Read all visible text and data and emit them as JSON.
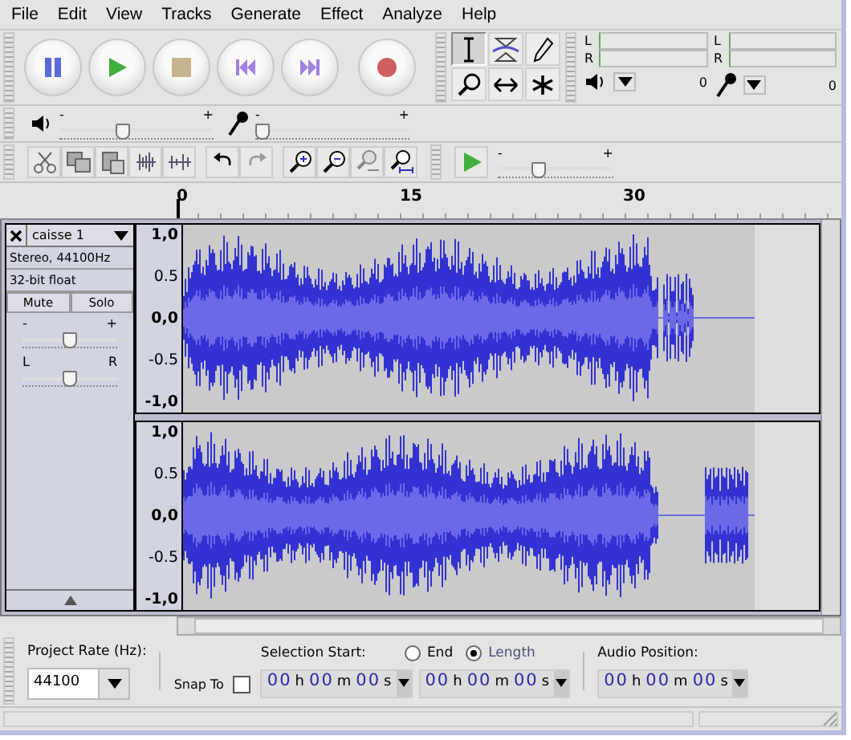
{
  "menu": [
    "File",
    "Edit",
    "View",
    "Tracks",
    "Generate",
    "Effect",
    "Analyze",
    "Help"
  ],
  "transport": [
    {
      "kind": "pause"
    },
    {
      "kind": "play"
    },
    {
      "kind": "stop"
    },
    {
      "kind": "start"
    },
    {
      "kind": "end"
    },
    {
      "kind": "record"
    }
  ],
  "tools": [
    {
      "kind": "select",
      "selected": true
    },
    {
      "kind": "envelope",
      "selected": false
    },
    {
      "kind": "draw",
      "selected": false
    },
    {
      "kind": "zoom",
      "selected": false
    },
    {
      "kind": "timeshift",
      "selected": false
    },
    {
      "kind": "multi",
      "selected": false
    }
  ],
  "meters": [
    {
      "kind": "playback",
      "channels": [
        "L",
        "R"
      ],
      "scale": "0"
    },
    {
      "kind": "record",
      "channels": [
        "L",
        "R"
      ],
      "scale": "0"
    }
  ],
  "mixer": [
    {
      "kind": "playback",
      "min": "-",
      "max": "+",
      "level": 0.4
    },
    {
      "kind": "record",
      "min": "-",
      "max": "+",
      "level": 0.0
    }
  ],
  "play_at_speed": {
    "min": "-",
    "max": "+",
    "level": 0.33
  },
  "ruler": [
    {
      "label": "0"
    },
    {
      "label": "15"
    },
    {
      "label": "30"
    }
  ],
  "track": {
    "name": "caisse 1",
    "info": [
      "Stereo, 44100Hz",
      "32-bit float"
    ],
    "buttons": [
      "Mute",
      "Solo"
    ],
    "gain": {
      "min": "-",
      "max": "+",
      "level": 0.5
    },
    "pan": {
      "min": "L",
      "max": "R",
      "level": 0.5
    },
    "channels": [
      {
        "scale": [
          "1,0",
          "0.5",
          "0,0",
          "-0.5",
          "-1,0"
        ]
      },
      {
        "scale": [
          "1,0",
          "0.5",
          "0,0",
          "-0.5",
          "-1,0"
        ]
      }
    ]
  },
  "selection_bar": {
    "rate_label": "Project Rate (Hz):",
    "rate": "44100",
    "snap_label": "Snap To",
    "snap_checked": false,
    "start_label": "Selection Start:",
    "modes": [
      {
        "label": "End",
        "selected": false
      },
      {
        "label": "Length",
        "selected": true
      }
    ],
    "position_label": "Audio Position:",
    "times": [
      [
        {
          "value": "00",
          "unit": "h"
        },
        {
          "value": "00",
          "unit": "m"
        },
        {
          "value": "00",
          "unit": "s"
        }
      ],
      [
        {
          "value": "00",
          "unit": "h"
        },
        {
          "value": "00",
          "unit": "m"
        },
        {
          "value": "00",
          "unit": "s"
        }
      ],
      [
        {
          "value": "00",
          "unit": "h"
        },
        {
          "value": "00",
          "unit": "m"
        },
        {
          "value": "00",
          "unit": "s"
        }
      ]
    ]
  }
}
